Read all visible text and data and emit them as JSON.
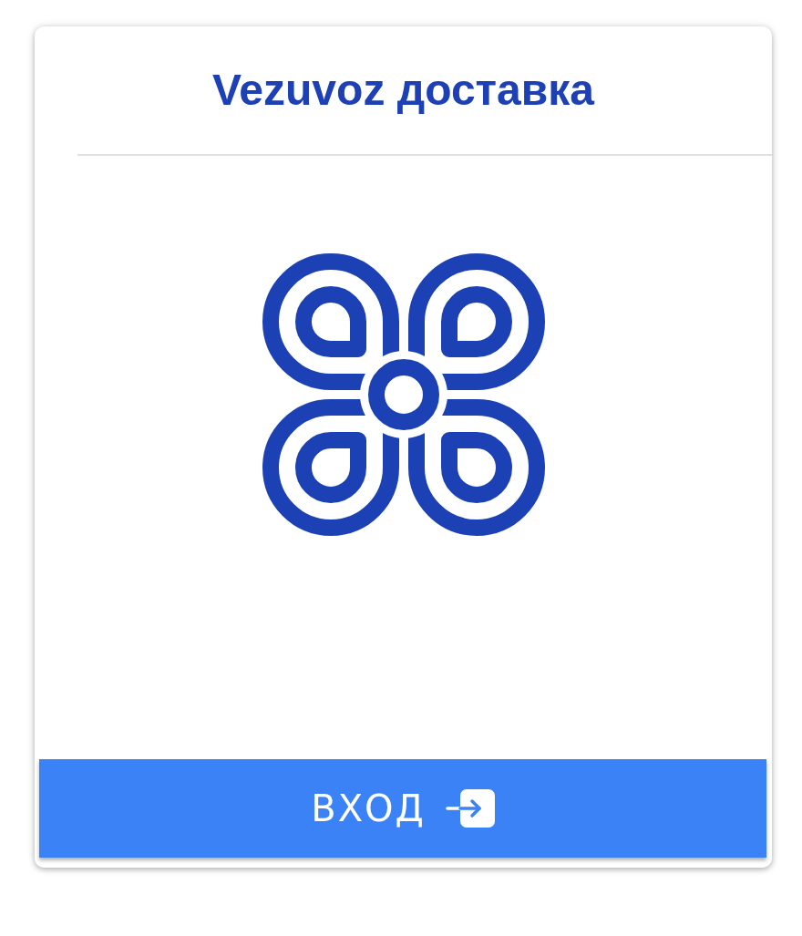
{
  "header": {
    "title": "Vezuvoz доставка"
  },
  "login_button": {
    "label": "ВХОД"
  }
}
